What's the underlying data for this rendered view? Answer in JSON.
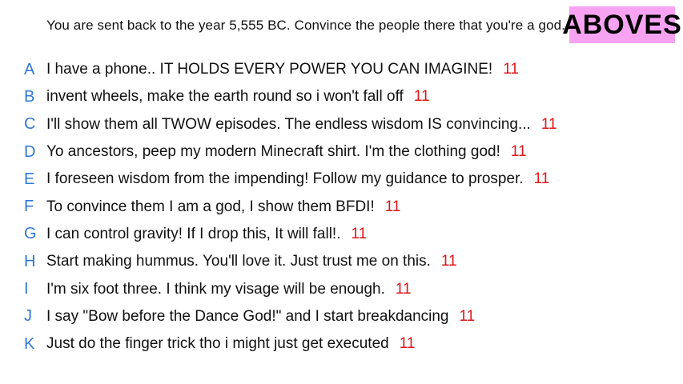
{
  "prompt": "You are sent back to the year 5,555 BC. Convince the people there that you're a god.",
  "badge": "ABOVES",
  "colors": {
    "letter": "#2f79d8",
    "votes": "#e0161b",
    "badge_bg": "#f7a3f2"
  },
  "responses": [
    {
      "letter": "A",
      "text": "I have a phone.. IT HOLDS EVERY POWER YOU CAN IMAGINE!",
      "votes": "11"
    },
    {
      "letter": "B",
      "text": "invent wheels, make the earth round so i won't fall off",
      "votes": "11"
    },
    {
      "letter": "C",
      "text": "I'll show them all TWOW episodes. The endless wisdom IS convincing...",
      "votes": "11"
    },
    {
      "letter": "D",
      "text": "Yo ancestors, peep my modern Minecraft shirt. I'm the clothing god!",
      "votes": "11"
    },
    {
      "letter": "E",
      "text": "I foreseen wisdom from the impending! Follow my guidance to prosper.",
      "votes": "11"
    },
    {
      "letter": "F",
      "text": "To convince them I am a god, I show them BFDI!",
      "votes": "11"
    },
    {
      "letter": "G",
      "text": "I can control gravity! If I drop this, It will fall!.",
      "votes": "11"
    },
    {
      "letter": "H",
      "text": "Start making hummus. You'll love it. Just trust me on this.",
      "votes": "11"
    },
    {
      "letter": "I",
      "text": "I'm six foot three. I think my visage will be enough.",
      "votes": "11"
    },
    {
      "letter": "J",
      "text": "I say \"Bow before the Dance God!\" and I start breakdancing",
      "votes": "11"
    },
    {
      "letter": "K",
      "text": "Just do the finger trick tho i might just get executed",
      "votes": "11"
    }
  ]
}
